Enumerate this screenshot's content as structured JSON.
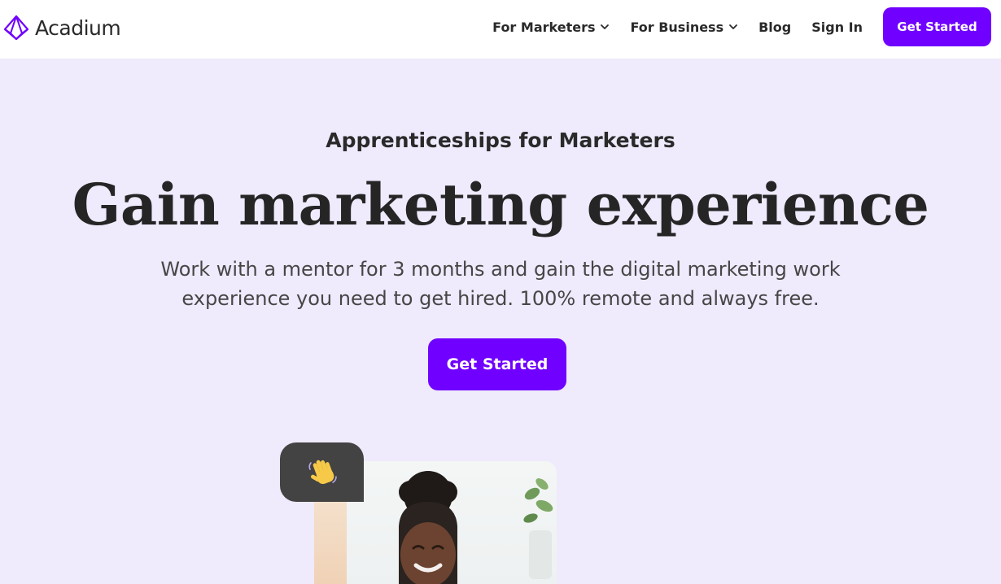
{
  "header": {
    "logo_text": "Acadium",
    "nav": [
      {
        "label": "For Marketers",
        "has_dropdown": true
      },
      {
        "label": "For Business",
        "has_dropdown": true
      },
      {
        "label": "Blog",
        "has_dropdown": false
      },
      {
        "label": "Sign In",
        "has_dropdown": false
      }
    ],
    "cta_label": "Get Started"
  },
  "hero": {
    "eyebrow": "Apprenticeships for Marketers",
    "headline": "Gain marketing experience",
    "subhead": "Work with a mentor for 3 months and gain the digital marketing work experience you need to get hired. 100% remote and always free.",
    "cta_label": "Get Started"
  },
  "media": {
    "bubble_icon": "waving-hand-icon",
    "photo": "smiling-woman-photo"
  },
  "colors": {
    "accent": "#7000ff",
    "background": "#efeafc",
    "bubble": "#434343"
  }
}
